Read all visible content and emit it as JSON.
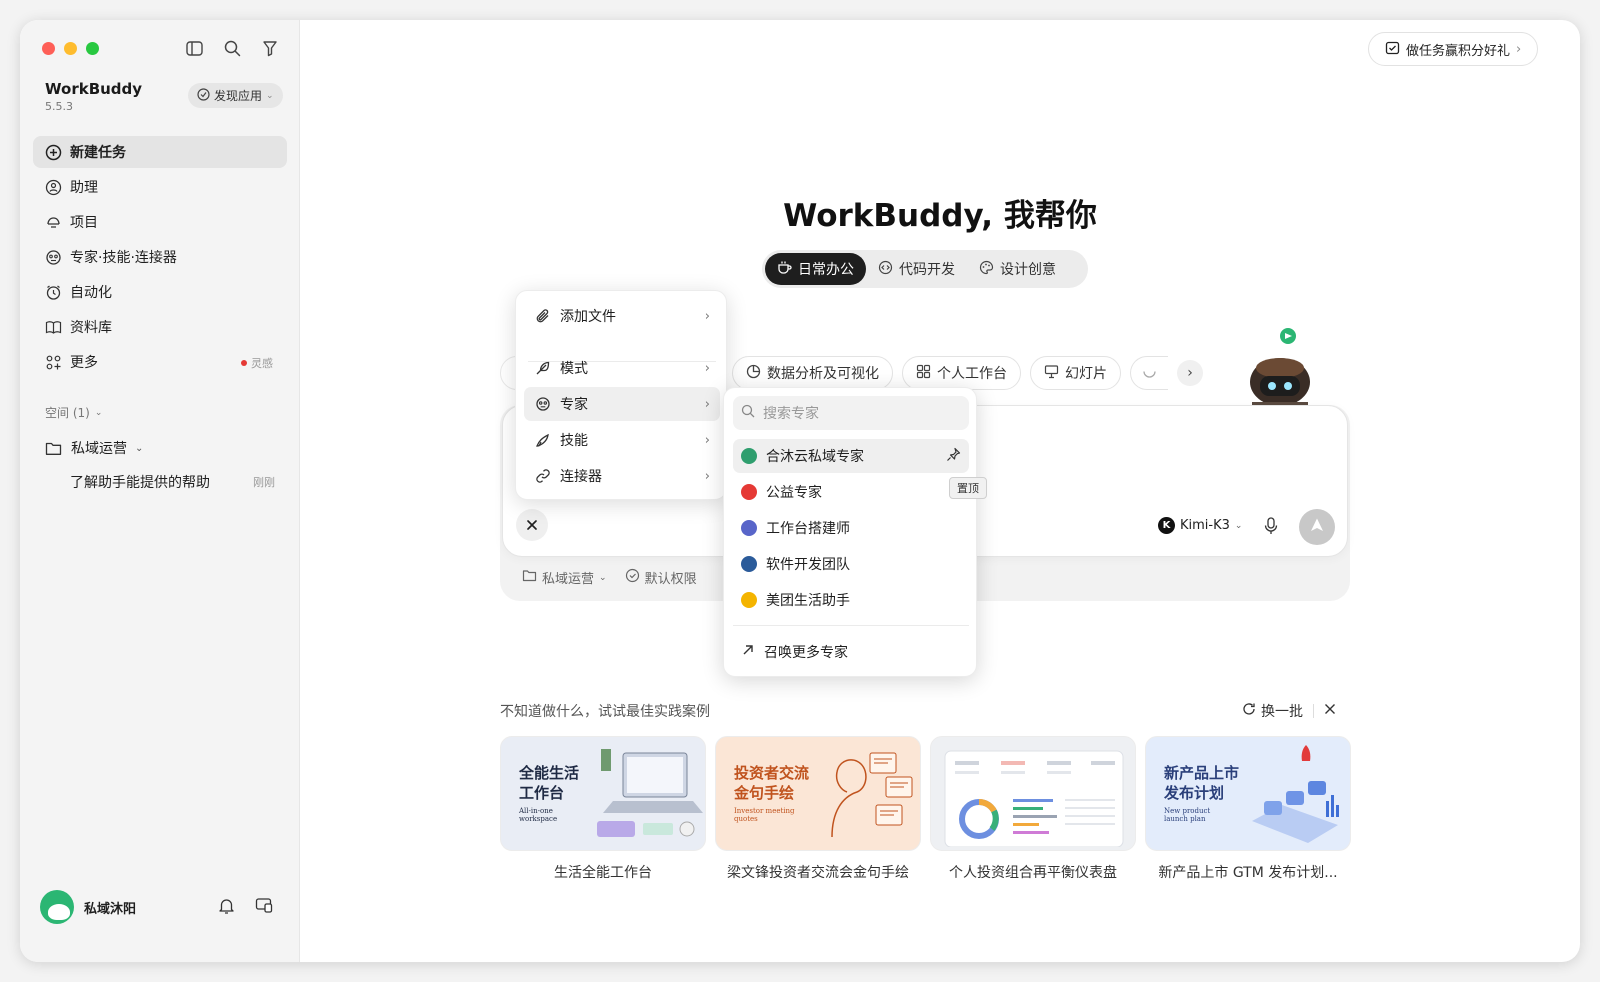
{
  "window": {
    "traffic_colors": [
      "#fe5f57",
      "#febc2e",
      "#28c840"
    ]
  },
  "sidebar": {
    "app_name": "WorkBuddy",
    "version": "5.5.3",
    "discover_label": "发现应用",
    "items": [
      {
        "label": "新建任务",
        "icon": "plus-circle-icon"
      },
      {
        "label": "助理",
        "icon": "assistant-icon"
      },
      {
        "label": "项目",
        "icon": "project-icon"
      },
      {
        "label": "专家·技能·连接器",
        "icon": "expert-icon"
      },
      {
        "label": "自动化",
        "icon": "alarm-icon"
      },
      {
        "label": "资料库",
        "icon": "book-icon"
      },
      {
        "label": "更多",
        "icon": "grid-icon",
        "badge": "灵感"
      }
    ],
    "space_label": "空间 (1)",
    "folder_label": "私域运营",
    "task_title": "了解助手能提供的帮助",
    "task_time": "刚刚",
    "user_name": "私域沐阳"
  },
  "header": {
    "reward_label": "做任务赢积分好礼"
  },
  "hero": {
    "title": "WorkBuddy, 我帮你"
  },
  "mode_tabs": [
    {
      "label": "日常办公",
      "icon": "coffee-icon",
      "active": true
    },
    {
      "label": "代码开发",
      "icon": "code-icon",
      "active": false
    },
    {
      "label": "设计创意",
      "icon": "palette-icon",
      "active": false
    }
  ],
  "chips": [
    {
      "label": "数据分析及可视化",
      "icon": "pie-chart-icon"
    },
    {
      "label": "个人工作台",
      "icon": "grid-icon"
    },
    {
      "label": "幻灯片",
      "icon": "presentation-icon"
    }
  ],
  "composer": {
    "model": "Kimi-K3",
    "model_logo": "K",
    "footer_folder": "私域运营",
    "footer_permission": "默认权限"
  },
  "menu": {
    "items": [
      {
        "label": "添加文件",
        "icon": "paperclip-icon"
      },
      {
        "label": "模式",
        "icon": "feather-icon"
      },
      {
        "label": "专家",
        "icon": "expert-icon"
      },
      {
        "label": "技能",
        "icon": "skill-icon"
      },
      {
        "label": "连接器",
        "icon": "link-icon"
      }
    ]
  },
  "expert_submenu": {
    "search_placeholder": "搜索专家",
    "items": [
      {
        "label": "合沐云私域专家",
        "color": "#2f9e6e"
      },
      {
        "label": "公益专家",
        "color": "#e53935"
      },
      {
        "label": "工作台搭建师",
        "color": "#5865c9"
      },
      {
        "label": "软件开发团队",
        "color": "#2b5b9a"
      },
      {
        "label": "美团生活助手",
        "color": "#f4b400"
      }
    ],
    "more_label": "召唤更多专家",
    "pin_tooltip": "置顶"
  },
  "suggestions": {
    "title": "不知道做什么，试试最佳实践案例",
    "refresh_label": "换一批",
    "cards": [
      {
        "art_title": "全能生活\n工作台",
        "art_sub": "All-in-one\nworkspace",
        "caption": "生活全能工作台",
        "bg": "#e9edf5",
        "fg": "#1f2a44"
      },
      {
        "art_title": "投资者交流\n金句手绘",
        "art_sub": "Investor meeting\nquotes",
        "caption": "梁文锋投资者交流会金句手绘",
        "bg": "#fbe6d6",
        "fg": "#c0531e"
      },
      {
        "art_title": "",
        "art_sub": "",
        "caption": "个人投资组合再平衡仪表盘",
        "bg": "#eef0f3",
        "fg": "#333"
      },
      {
        "art_title": "新产品上市\n发布计划",
        "art_sub": "New product\nlaunch plan",
        "caption": "新产品上市 GTM 发布计划...",
        "bg": "#e3ecfb",
        "fg": "#2a3f7a"
      }
    ]
  }
}
